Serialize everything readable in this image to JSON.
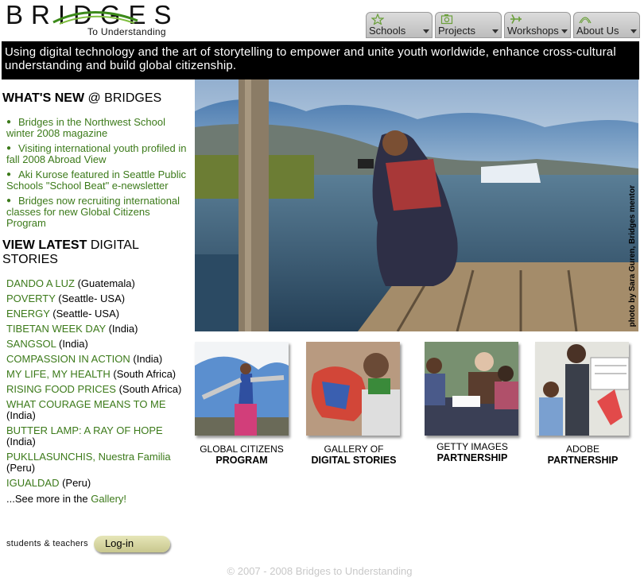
{
  "logo": {
    "word": "BRIDGES",
    "sub": "To Understanding"
  },
  "nav": [
    {
      "label": "Schools",
      "icon": "star-icon"
    },
    {
      "label": "Projects",
      "icon": "camera-icon"
    },
    {
      "label": "Workshops",
      "icon": "airplane-icon"
    },
    {
      "label": "About Us",
      "icon": "arch-icon"
    }
  ],
  "tagline": "Using digital technology and the art of storytelling to empower and unite youth worldwide, enhance cross-cultural understanding and build global citizenship.",
  "whats_new": {
    "title_bold": "WHAT'S NEW",
    "title_rest": " @ BRIDGES",
    "items": [
      "Bridges in the Northwest School winter 2008 magazine",
      "Visiting international youth profiled in fall 2008 Abroad View",
      "Aki Kurose featured in Seattle Public Schools \"School Beat\" e-newsletter",
      "Bridges now recruiting international classes for new Global Citizens Program"
    ]
  },
  "stories": {
    "title_bold": "VIEW LATEST",
    "title_rest": " DIGITAL STORIES",
    "items": [
      {
        "title": "DANDO A LUZ",
        "loc": " (Guatemala)"
      },
      {
        "title": "POVERTY",
        "loc": " (Seattle- USA)"
      },
      {
        "title": "ENERGY",
        "loc": " (Seattle- USA)"
      },
      {
        "title": "TIBETAN WEEK DAY",
        "loc": " (India)"
      },
      {
        "title": "SANGSOL",
        "loc": " (India)"
      },
      {
        "title": "COMPASSION IN ACTION",
        "loc": " (India)"
      },
      {
        "title": "MY LIFE, MY HEALTH",
        "loc": " (South Africa)"
      },
      {
        "title": "RISING FOOD PRICES",
        "loc": " (South Africa)"
      },
      {
        "title": "WHAT COURAGE MEANS TO ME",
        "loc": " (India)"
      },
      {
        "title": "BUTTER LAMP: A RAY OF HOPE",
        "loc": " (India)"
      },
      {
        "title": "PUKLLASUNCHIS, Nuestra Familia",
        "loc": " (Peru)"
      },
      {
        "title": "IGUALDAD",
        "loc": " (Peru)"
      }
    ],
    "see_more_prefix": "...See more in the ",
    "see_more_link": "Gallery!"
  },
  "login": {
    "label": "students & teachers",
    "button": "Log-in"
  },
  "hero": {
    "credit": "photo by Sara Guren, Bridges mentor"
  },
  "partners": [
    {
      "line1": "GLOBAL CITIZENS",
      "line2": "PROGRAM"
    },
    {
      "line1": "GALLERY OF",
      "line2": "DIGITAL STORIES"
    },
    {
      "line1": "GETTY IMAGES",
      "line2": "PARTNERSHIP"
    },
    {
      "line1": "ADOBE",
      "line2": "PARTNERSHIP"
    }
  ],
  "footer": "© 2007 - 2008 Bridges to Understanding",
  "colors": {
    "link_green": "#3c7a1a",
    "tagline_bg": "#000000",
    "footer_gray": "#c8c8c8"
  }
}
